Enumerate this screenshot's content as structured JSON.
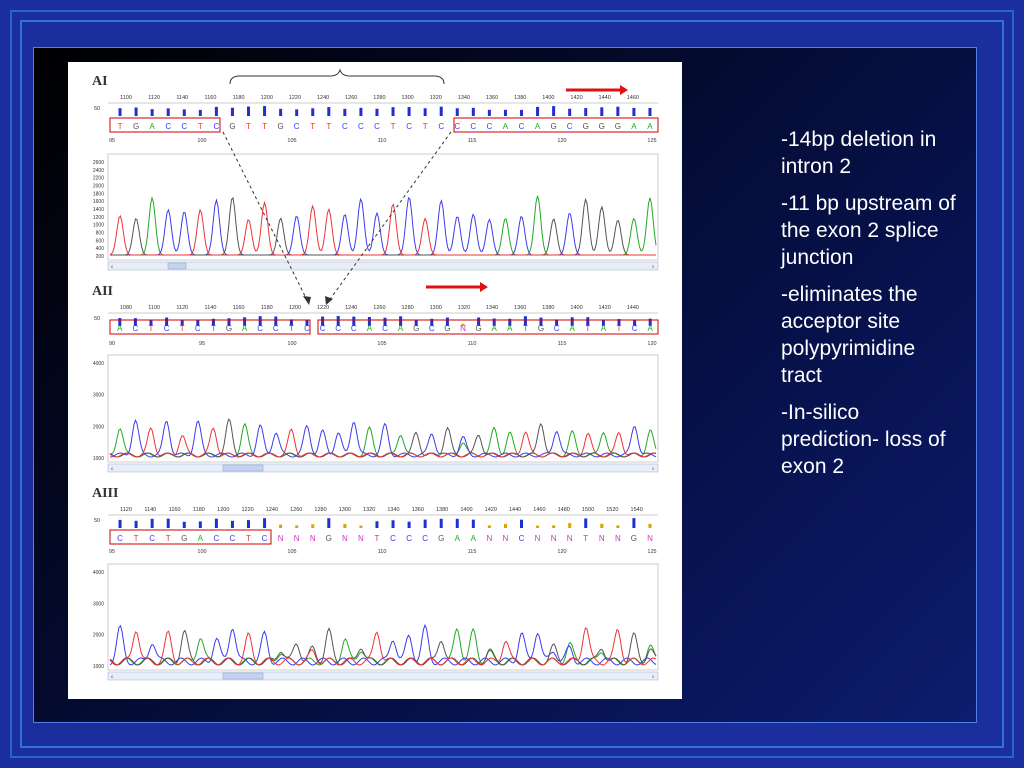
{
  "bullets": [
    "-14bp deletion in intron 2",
    "-11 bp upstream of the exon 2 splice junction",
    "-eliminates the acceptor site polypyrimidine tract",
    "-In-silico prediction- loss of exon 2"
  ],
  "colors": {
    "slide_bg": "#1b2f9c",
    "text": "#ffffff",
    "trace_A": "#22aa22",
    "trace_C": "#3b3bf0",
    "trace_G": "#555555",
    "trace_T": "#ee3333",
    "highlight_box": "#cc0000",
    "arrow": "#e01010"
  },
  "panels": [
    {
      "label": "AI",
      "ruler": [
        "1100",
        "1120",
        "1140",
        "1160",
        "1180",
        "1200",
        "1220",
        "1240",
        "1260",
        "1280",
        "1300",
        "1320",
        "1340",
        "1360",
        "1380",
        "1400",
        "1420",
        "1440",
        "1460"
      ],
      "quality_label": "50",
      "bases": [
        "T",
        "G",
        "A",
        "C",
        "C",
        "T",
        "C",
        "G",
        "T",
        "T",
        "G",
        "C",
        "T",
        "T",
        "C",
        "C",
        "C",
        "T",
        "C",
        "T",
        "C",
        "C",
        "C",
        "C",
        "A",
        "C",
        "A",
        "G",
        "C",
        "G",
        "G",
        "G",
        "A",
        "A"
      ],
      "positions": [
        "95",
        "100",
        "105",
        "110",
        "115",
        "120",
        "125"
      ],
      "yticks": [
        "2600",
        "2400",
        "2200",
        "2000",
        "1800",
        "1600",
        "1400",
        "1200",
        "1000",
        "800",
        "600",
        "400",
        "200"
      ]
    },
    {
      "label": "AII",
      "ruler": [
        "1080",
        "1100",
        "1120",
        "1140",
        "1160",
        "1180",
        "1200",
        "1220",
        "1240",
        "1260",
        "1280",
        "1300",
        "1320",
        "1340",
        "1360",
        "1380",
        "1400",
        "1420",
        "1440"
      ],
      "quality_label": "50",
      "bases": [
        "A",
        "C",
        "T",
        "C",
        "T",
        "C",
        "T",
        "G",
        "A",
        "C",
        "C",
        "T",
        "C",
        "C",
        "C",
        "C",
        "A",
        "C",
        "A",
        "G",
        "C",
        "G",
        "N",
        "G",
        "A",
        "A",
        "T",
        "G",
        "C",
        "A",
        "T",
        "A",
        "T",
        "C",
        "A"
      ],
      "positions": [
        "90",
        "95",
        "100",
        "105",
        "110",
        "115",
        "120"
      ],
      "yticks": [
        "4000",
        "3000",
        "2000",
        "1000"
      ]
    },
    {
      "label": "AIII",
      "ruler": [
        "1120",
        "1140",
        "1160",
        "1180",
        "1200",
        "1220",
        "1240",
        "1260",
        "1280",
        "1300",
        "1320",
        "1340",
        "1360",
        "1380",
        "1400",
        "1420",
        "1440",
        "1460",
        "1480",
        "1500",
        "1520",
        "1540"
      ],
      "quality_label": "50",
      "bases": [
        "C",
        "T",
        "C",
        "T",
        "G",
        "A",
        "C",
        "C",
        "T",
        "C",
        "N",
        "N",
        "N",
        "G",
        "N",
        "N",
        "T",
        "C",
        "C",
        "C",
        "G",
        "A",
        "A",
        "N",
        "N",
        "C",
        "N",
        "N",
        "N",
        "T",
        "N",
        "N",
        "G",
        "N"
      ],
      "positions": [
        "95",
        "100",
        "105",
        "110",
        "115",
        "120",
        "125"
      ],
      "yticks": [
        "4000",
        "3000",
        "2000",
        "1000"
      ]
    }
  ]
}
